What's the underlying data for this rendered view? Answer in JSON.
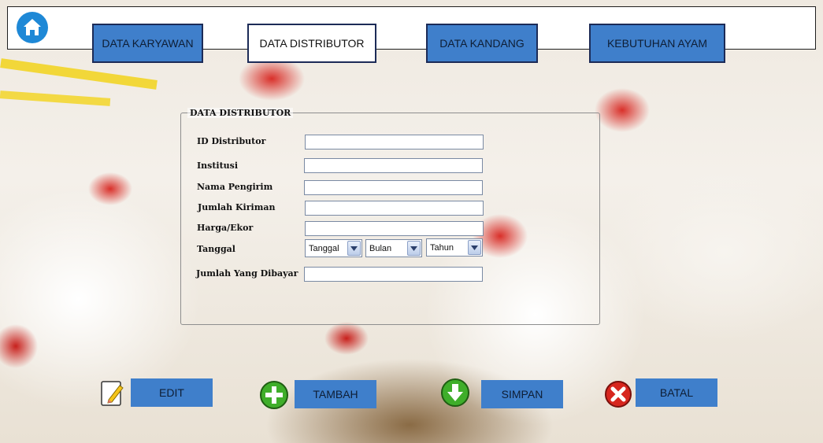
{
  "nav": {
    "home_icon": "home-icon",
    "tabs": [
      {
        "label": "DATA KARYAWAN"
      },
      {
        "label": "DATA DISTRIBUTOR"
      },
      {
        "label": "DATA KANDANG"
      },
      {
        "label": "KEBUTUHAN AYAM"
      }
    ],
    "active_tab": "DATA DISTRIBUTOR"
  },
  "form": {
    "title": "DATA DISTRIBUTOR",
    "fields": [
      {
        "label": "ID Distributor",
        "value": ""
      },
      {
        "label": "Institusi",
        "value": ""
      },
      {
        "label": "Nama Pengirim",
        "value": ""
      },
      {
        "label": "Jumlah Kiriman",
        "value": ""
      },
      {
        "label": "Harga/Ekor",
        "value": ""
      },
      {
        "label": "Tanggal"
      },
      {
        "label": "Jumlah Yang Dibayar",
        "value": ""
      }
    ],
    "date": {
      "day": "Tanggal",
      "month": "Bulan",
      "year": "Tahun"
    }
  },
  "actions": {
    "edit": {
      "label": "EDIT",
      "icon": "edit-note-icon"
    },
    "tambah": {
      "label": "TAMBAH",
      "icon": "add-plus-icon"
    },
    "simpan": {
      "label": "SIMPAN",
      "icon": "down-arrow-save-icon"
    },
    "batal": {
      "label": "BATAL",
      "icon": "cancel-x-icon"
    }
  },
  "colors": {
    "tab_blue": "#3f7fcb",
    "tab_border": "#1c2b57",
    "home_blue": "#1e88d6",
    "add_green": "#3fae2a",
    "cancel_red": "#d7261e"
  }
}
